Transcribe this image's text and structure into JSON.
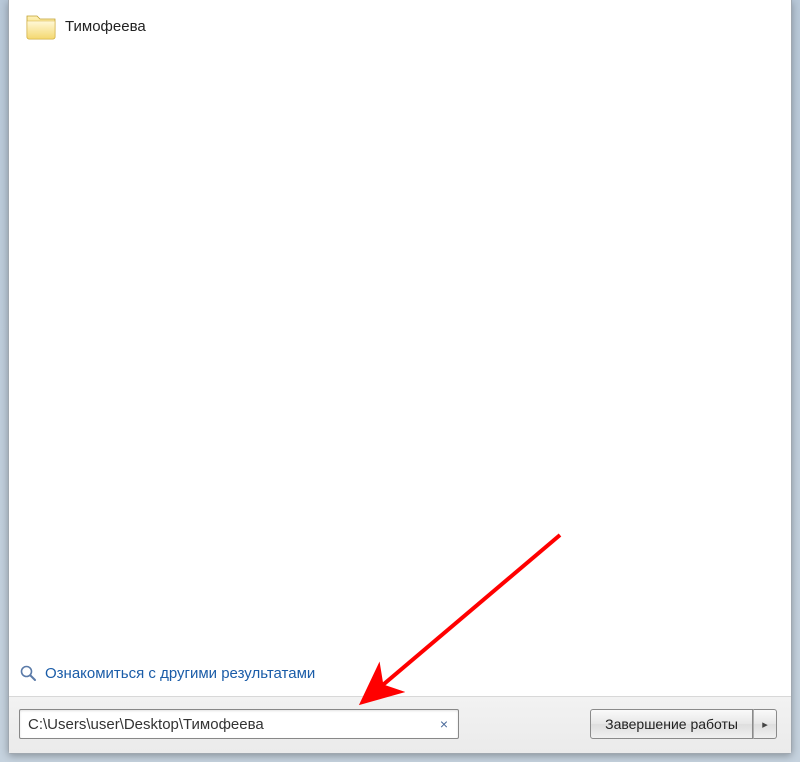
{
  "result": {
    "folder_name": "Тимофеева"
  },
  "more_results": {
    "label": "Ознакомиться с другими результатами"
  },
  "search": {
    "value": "C:\\Users\\user\\Desktop\\Тимофеева",
    "clear_symbol": "×"
  },
  "shutdown": {
    "label": "Завершение работы",
    "arrow": "▸"
  }
}
